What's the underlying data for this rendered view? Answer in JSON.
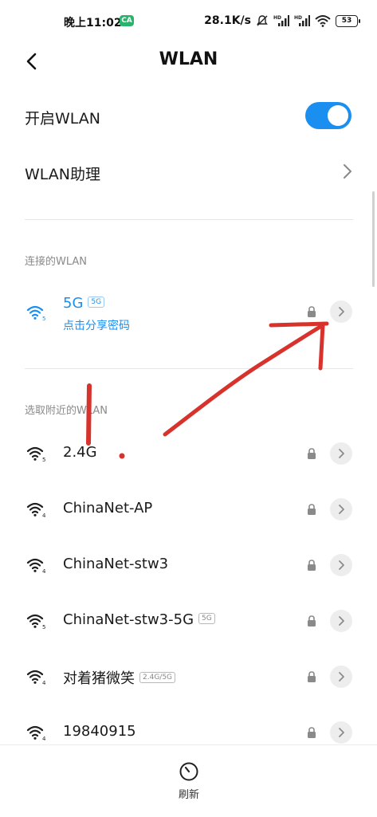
{
  "status_bar": {
    "time": "晚上11:02",
    "badge": "CA",
    "speed": "28.1K/s",
    "battery": "53"
  },
  "header": {
    "title": "WLAN"
  },
  "settings": {
    "wlan_toggle_label": "开启WLAN",
    "wlan_enabled": true,
    "assistant_label": "WLAN助理"
  },
  "connected_section": {
    "title": "连接的WLAN",
    "network": {
      "name": "5G",
      "band": "5G",
      "subtitle": "点击分享密码",
      "locked": true,
      "signal": "5"
    }
  },
  "nearby_section": {
    "title": "选取附近的WLAN",
    "networks": [
      {
        "name": "2.4G",
        "band": "",
        "signal": "5",
        "locked": true
      },
      {
        "name": "ChinaNet-AP",
        "band": "",
        "signal": "4",
        "locked": true
      },
      {
        "name": "ChinaNet-stw3",
        "band": "",
        "signal": "4",
        "locked": true
      },
      {
        "name": "ChinaNet-stw3-5G",
        "band": "5G",
        "signal": "5",
        "locked": true
      },
      {
        "name": "对着猪微笑",
        "band": "2.4G/5G",
        "signal": "4",
        "locked": true
      },
      {
        "name": "19840915",
        "band": "",
        "signal": "4",
        "locked": true
      }
    ]
  },
  "bottom_bar": {
    "refresh_label": "刷新"
  },
  "annotation": {
    "marker_text": "1.",
    "color": "#d7332c"
  },
  "colors": {
    "accent": "#1b8ff0"
  }
}
